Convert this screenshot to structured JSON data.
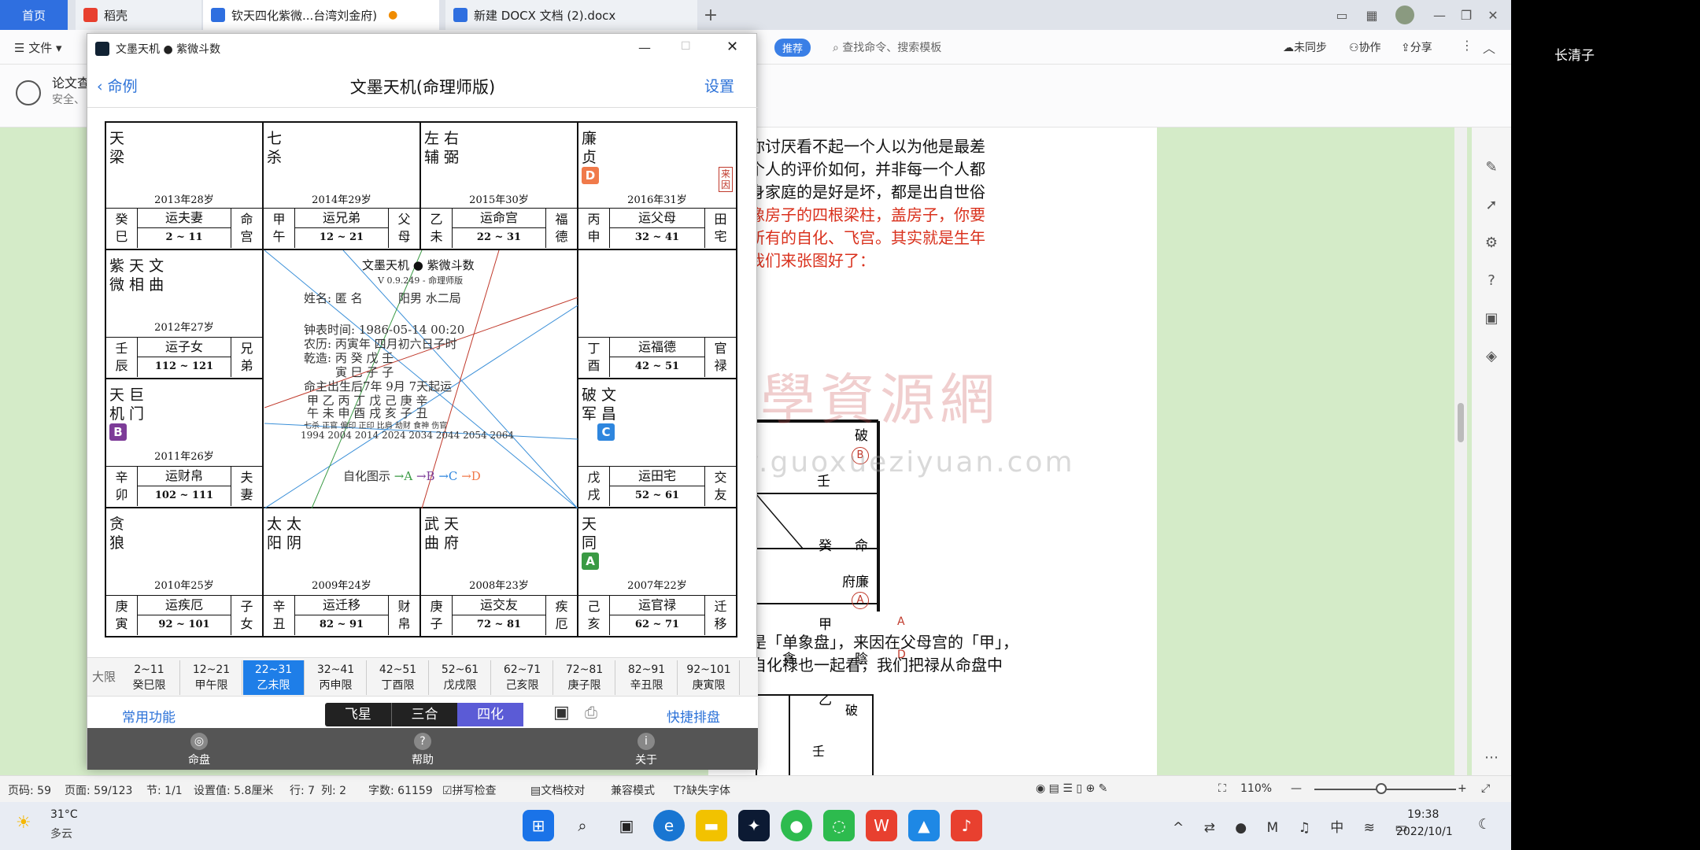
{
  "tabs": {
    "home": "首页",
    "daoke": "稻壳",
    "doc1": "钦天四化紫微...台湾刘金府)",
    "doc2": "新建 DOCX 文档 (2).docx"
  },
  "menu": {
    "file": "文件",
    "recommend": "推荐",
    "search_placeholder": "查找命令、搜索模板",
    "sync": "未同步",
    "collab": "协作",
    "share": "分享"
  },
  "ribbon": {
    "title": "论文查",
    "subtitle": "安全、"
  },
  "dark_panel": {
    "user": "长清子"
  },
  "doc": {
    "lines": [
      "成你讨厌看不起一个人以为他是最差",
      "一个人的评价如何，并非每一个人都",
      "出身家庭的是好是坏，都是出自世俗",
      "就像房子的四根梁柱，盖房子，你要",
      "中所有的自化、飞宫。其实就是生年",
      "，我们来张图好了："
    ],
    "lines_after": [
      "是「单象盘」，来因在父母宫的「甲」，",
      "自化禄也一起看，我们把禄从命盘中"
    ],
    "watermark_cn": "國學資源網",
    "watermark_url": "www.guoxueziyuan.com",
    "diagram_labels": {
      "po": "破",
      "ren": "壬",
      "ming": "命",
      "gui": "癸",
      "fulian": "府廉",
      "jia": "甲",
      "tan": "貪",
      "yin": "陰",
      "yi": "乙",
      "A": "A",
      "D": "D",
      "b_circ": "B",
      "a_circ": "A",
      "po2": "破",
      "ren2": "壬"
    }
  },
  "zw": {
    "window_title": "文墨天机 ● 紫微斗数",
    "back": "命例",
    "heading": "文墨天机(命理师版)",
    "settings": "设置",
    "palaces": [
      {
        "stars": "天\n梁",
        "year": "2013年28岁",
        "gz": "癸\n巳",
        "yun": "运夫妻",
        "age": "2 ~ 11",
        "pal": "命\n宫"
      },
      {
        "stars": "七\n杀",
        "year": "2014年29岁",
        "gz": "甲\n午",
        "yun": "运兄弟",
        "age": "12 ~ 21",
        "pal": "父\n母"
      },
      {
        "stars": "左 右\n辅 弼",
        "year": "2015年30岁",
        "gz": "乙\n未",
        "yun": "运命宫",
        "age": "22 ~ 31",
        "pal": "福\n德"
      },
      {
        "stars": "廉\n贞",
        "year": "2016年31岁",
        "gz": "丙\n申",
        "yun": "运父母",
        "age": "32 ~ 41",
        "pal": "田\n宅",
        "laiyin": "来\n因"
      },
      {
        "stars": "紫 天 文\n微 相 曲",
        "year": "2012年27岁",
        "gz": "壬\n辰",
        "yun": "运子女",
        "age": "112 ~ 121",
        "pal": "兄\n弟"
      },
      {
        "stars": "",
        "year": "",
        "gz": "丁\n酉",
        "yun": "运福德",
        "age": "42 ~ 51",
        "pal": "官\n禄"
      },
      {
        "stars": "天 巨\n机 门",
        "year": "2011年26岁",
        "gz": "辛\n卯",
        "yun": "运财帛",
        "age": "102 ~ 111",
        "pal": "夫\n妻"
      },
      {
        "stars": "破 文\n军 昌",
        "year": "",
        "gz": "戊\n戌",
        "yun": "运田宅",
        "age": "52 ~ 61",
        "pal": "交\n友"
      },
      {
        "stars": "贪\n狼",
        "year": "2010年25岁",
        "gz": "庚\n寅",
        "yun": "运疾厄",
        "age": "92 ~ 101",
        "pal": "子\n女"
      },
      {
        "stars": "太 太\n阳 阴",
        "year": "2009年24岁",
        "gz": "辛\n丑",
        "yun": "运迁移",
        "age": "82 ~ 91",
        "pal": "财\n帛"
      },
      {
        "stars": "武 天\n曲 府",
        "year": "2008年23岁",
        "gz": "庚\n子",
        "yun": "运交友",
        "age": "72 ~ 81",
        "pal": "疾\n厄"
      },
      {
        "stars": "天\n同",
        "year": "2007年22岁",
        "gz": "己\n亥",
        "yun": "运官禄",
        "age": "62 ~ 71",
        "pal": "迁\n移"
      }
    ],
    "badges": {
      "D": "D",
      "B": "B",
      "C": "C",
      "A": "A"
    },
    "center": {
      "title": "文墨天机 ● 紫微斗数",
      "version": "V 0.9.249 - 命理师版",
      "name": "姓名: 匿 名",
      "gender": "阳男 水二局",
      "clock": "钟表时间: 1986-05-14 00:20",
      "lunar": "农历: 丙寅年 四月初六日子时",
      "bazi1": "乾造: 丙     癸     戊     壬",
      "bazi2": "寅     巳     子     子",
      "start": "命主出生后7年 9月 7天起运",
      "row1": "甲   乙   丙   丁   戊   己   庚   辛",
      "row2": "午   未   申   酉   戌   亥   子   丑",
      "row3": "七杀 正官 偏印 正印 比肩 劫财 食神 伤官",
      "row4": "1994 2004 2014 2024 2034 2044 2054 2064",
      "legend_label": "自化图示",
      "legend_a": "→A",
      "legend_b": "→B",
      "legend_c": "→C",
      "legend_d": "→D"
    },
    "daxian_label": "大限",
    "daxian": [
      {
        "range": "2~11",
        "gz": "癸巳限"
      },
      {
        "range": "12~21",
        "gz": "甲午限"
      },
      {
        "range": "22~31",
        "gz": "乙未限"
      },
      {
        "range": "32~41",
        "gz": "丙申限"
      },
      {
        "range": "42~51",
        "gz": "丁酉限"
      },
      {
        "range": "52~61",
        "gz": "戊戌限"
      },
      {
        "range": "62~71",
        "gz": "己亥限"
      },
      {
        "range": "72~81",
        "gz": "庚子限"
      },
      {
        "range": "82~91",
        "gz": "辛丑限"
      },
      {
        "range": "92~101",
        "gz": "庚寅限"
      }
    ],
    "common": "常用功能",
    "modes": [
      "飞星",
      "三合",
      "四化"
    ],
    "quick": "快捷排盘",
    "nav": [
      {
        "label": "命盘",
        "icon": "chart-icon"
      },
      {
        "label": "帮助",
        "icon": "help-icon"
      },
      {
        "label": "关于",
        "icon": "info-icon"
      }
    ]
  },
  "status": {
    "page": "页码: 59",
    "pages": "页面: 59/123",
    "section": "节: 1/1",
    "setting": "设置值: 5.8厘米",
    "row": "行: 7",
    "col": "列: 2",
    "words": "字数: 61159",
    "spell": "拼写检查",
    "proof": "文档校对",
    "compat": "兼容模式",
    "font": "缺失字体",
    "zoom": "110%"
  },
  "weather": {
    "temp": "31°C",
    "desc": "多云"
  },
  "clock": {
    "time": "19:38",
    "date": "2022/10/1"
  },
  "colors": {
    "accent": "#2f6fe0",
    "red_text": "#d9301c",
    "sel": "#1e7ee8"
  }
}
